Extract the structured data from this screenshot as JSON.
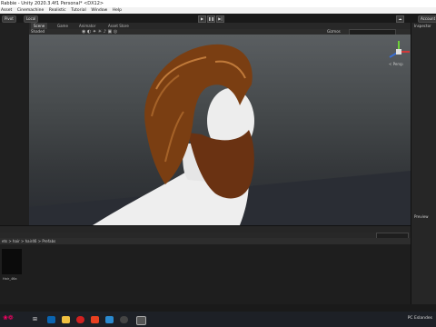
{
  "titlebar": {
    "title": "Rabbie - Unity 2020.3.4f1 Personal* <DX12>"
  },
  "menu": [
    "Asset",
    "Cinemachine",
    "Realistic",
    "Tutorial",
    "Window",
    "Help"
  ],
  "toolbar": {
    "pivot": "Pivot",
    "local": "Local",
    "account": "Account"
  },
  "tabs": [
    "Scene",
    "Game",
    "Animator",
    "Asset Store"
  ],
  "scene_bar": {
    "shading": "Shaded",
    "gizmos": "Gizmos"
  },
  "gizmo": {
    "label": "< Persp"
  },
  "right_panel": {
    "inspector": "Inspector",
    "preview": "Preview"
  },
  "breadcrumb": "ets > hair > hair46 > Prefabs",
  "project": {
    "thumb_label": "Hair_46a"
  },
  "taskbar": {
    "tray_text": "PC Eslandes"
  },
  "colors": {
    "hair": "#7a3e12",
    "beard": "#6a3212",
    "skin": "#e8e8e8"
  }
}
